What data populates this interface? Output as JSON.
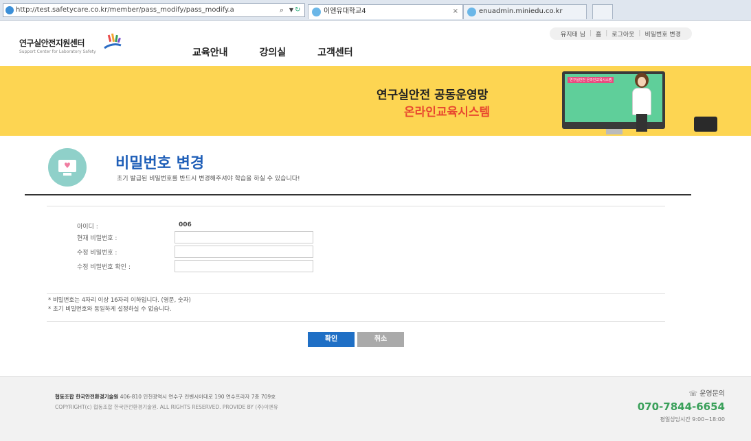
{
  "browser": {
    "url": "http://test.safetycare.co.kr/member/pass_modify/pass_modify.a",
    "tabs": [
      {
        "label": "이엔유대학교4"
      },
      {
        "label": "enuadmin.miniedu.co.kr"
      },
      {
        "label": ""
      }
    ]
  },
  "header": {
    "util_nav": [
      "유지태 님",
      "홈",
      "로그아웃",
      "비밀번호 변경"
    ],
    "logo_text": "연구실안전지원센터",
    "logo_sub": "Support Center for Laboratory Safety",
    "main_nav": [
      "교육안내",
      "강의실",
      "고객센터"
    ]
  },
  "banner": {
    "title1": "연구실안전 공동운영망",
    "title2": "온라인교육시스템",
    "screen_label": "연구실안전 온라인교육시스템"
  },
  "page": {
    "title": "비밀번호 변경",
    "description": "초기 발급된 비밀번호를 반드시 변경해주셔야 학습을 하실 수 있습니다!",
    "form": {
      "id_label": "아이디 :",
      "id_value": "006",
      "current_pw_label": "현재 비밀번호 :",
      "new_pw_label": "수정 비밀번호 :",
      "confirm_pw_label": "수정 비밀번호 확인 :"
    },
    "notes": [
      "* 비밀번호는 4자리 이상 16자리 이하입니다. (영문, 숫자)",
      "* 초기 비밀번호와 동일하게 설정하실 수 없습니다."
    ],
    "buttons": {
      "ok": "확인",
      "cancel": "취소"
    }
  },
  "footer": {
    "company": "협동조합 한국안전환경기술원",
    "address": "406-810 인천광역시 연수구 컨벤시아대로 190 연수프라자 7층 709호",
    "copyright": "COPYRIGHT(c) 협동조합 한국안전환경기술원. ALL RIGHTS RESERVED. PROVIDE BY (주)이엔유",
    "contact_label": "운영문의",
    "phone": "070-7844-6654",
    "hours": "평일상담시간 9:00~18:00"
  },
  "colors": {
    "banner": "#fdd552",
    "accent_blue": "#1f5fb8",
    "banner_red": "#e8482f",
    "phone_green": "#3aa05a"
  }
}
